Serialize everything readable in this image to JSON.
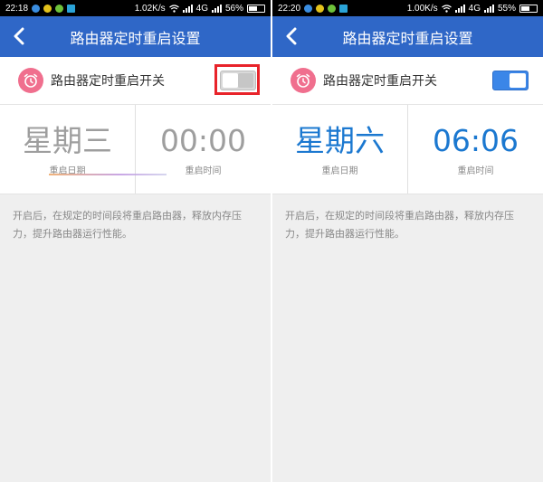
{
  "left": {
    "status": {
      "time": "22:18",
      "speed": "1.02K/s",
      "network": "4G",
      "battery": "56%",
      "battery_level": 0.56
    },
    "title": "路由器定时重启设置",
    "switch_label": "路由器定时重启开关",
    "switch_state": "off",
    "day": "星期三",
    "day_caption": "重启日期",
    "time": "00:00",
    "time_caption": "重启时间",
    "description": "开启后，在规定的时间段将重启路由器，释放内存压力，提升路由器运行性能。"
  },
  "right": {
    "status": {
      "time": "22:20",
      "speed": "1.00K/s",
      "network": "4G",
      "battery": "55%",
      "battery_level": 0.55
    },
    "title": "路由器定时重启设置",
    "switch_label": "路由器定时重启开关",
    "switch_state": "on",
    "day": "星期六",
    "day_caption": "重启日期",
    "time": "06:06",
    "time_caption": "重启时间",
    "description": "开启后，在规定的时间段将重启路由器，释放内存压力，提升路由器运行性能。"
  },
  "colors": {
    "titlebar": "#2f67c7",
    "accent_blue": "#1b78d0",
    "alarm_icon": "#f06f8e",
    "highlight": "#e8232a",
    "inactive_text": "#9e9e9e"
  },
  "icons": [
    "back-arrow-icon",
    "alarm-clock-icon",
    "wifi-icon",
    "signal-icon",
    "battery-icon"
  ]
}
